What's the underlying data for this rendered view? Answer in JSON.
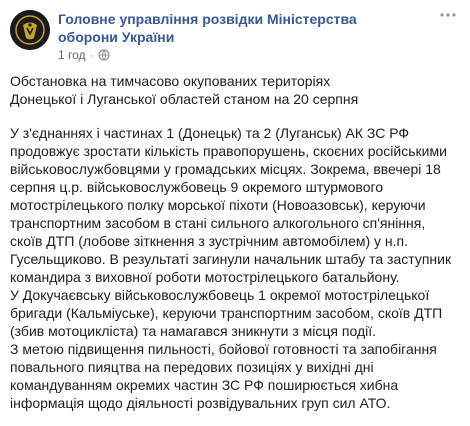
{
  "post": {
    "page_name": "Головне управління розвідки Міністерства оборони України",
    "timestamp": "1 год",
    "separator": "·",
    "title_lines": [
      "Обстановка на тимчасово окупованих територіях",
      "Донецької і Луганської областей станом на 20 серпня"
    ],
    "body_lines": [
      "У з'єднаннях і частинах 1 (Донецьк) та 2 (Луганськ) АК ЗС РФ",
      "продовжує зростати кількість правопорушень, скоєних російськими",
      "військовослужбовцями у громадських місцях. Зокрема, ввечері 18",
      "серпня ц.р. військовослужбовець 9 окремого штурмового",
      "мотострілецького полку морської піхоти (Новоазовськ), керуючи",
      "транспортним засобом в стані сильного алкогольного сп'яніння,",
      "скоїв ДТП (лобове зіткнення з зустрічним автомобілем) у н.п.",
      "Гусельщиково. В результаті загинули начальник штабу та заступник",
      "командира з виховної роботи мотострілецького батальйону.",
      "У Докучаєвську військовослужбовець 1 окремої мотострілецької",
      "бригади (Кальміуське), керуючи транспортним засобом, скоїв ДТП",
      "(збив мотоцикліста) та намагався зникнути з місця події.",
      "З метою підвищення пильності, бойової готовності та запобігання",
      "повального пияцтва на передових позиціях у вихідні дні",
      "командуванням окремих частин ЗС РФ поширюється хибна",
      "інформація щодо діяльності розвідувальних груп сил АТО."
    ]
  },
  "icons": {
    "avatar": "military-intelligence-emblem",
    "privacy": "globe-icon",
    "more": "more-options-icon"
  },
  "colors": {
    "page_name": "#385898",
    "meta": "#616770",
    "text": "#1c1e21"
  }
}
